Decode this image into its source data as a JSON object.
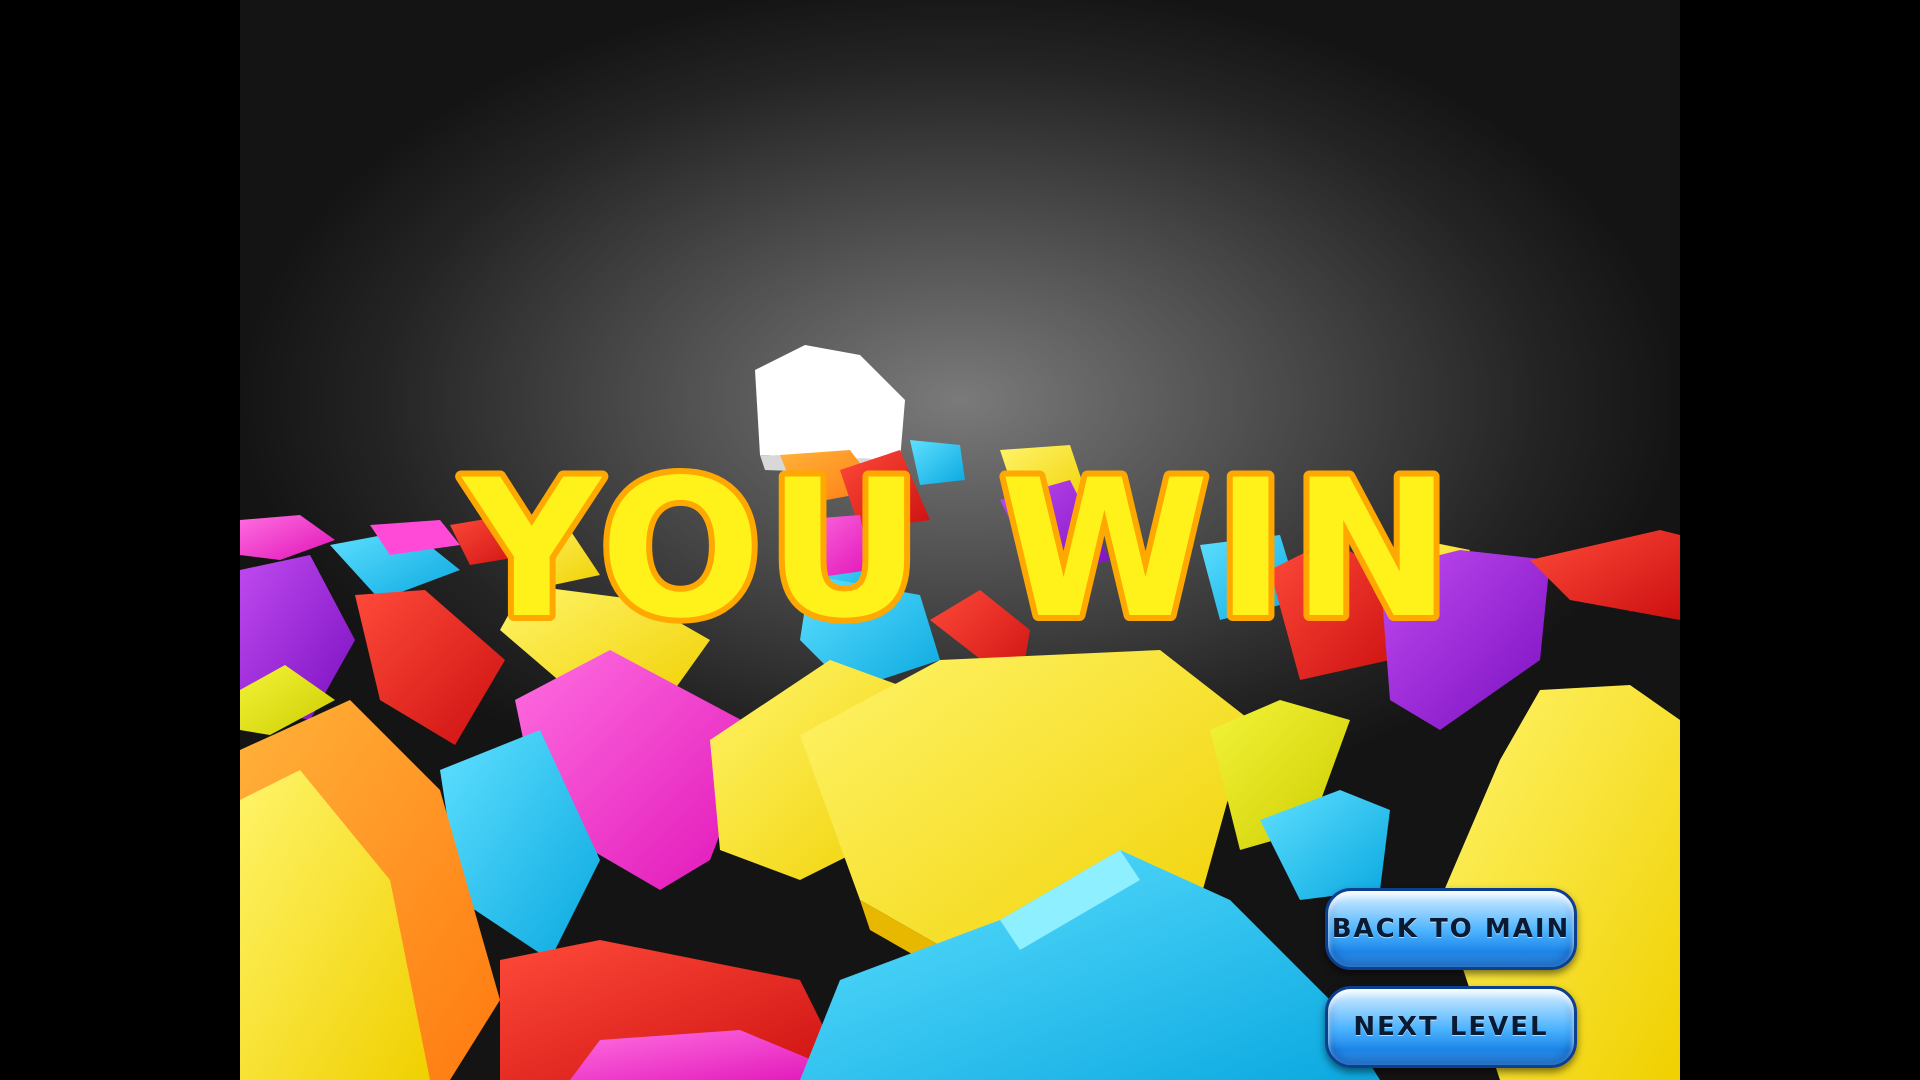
{
  "game": {
    "title": "YOU WIN",
    "title_colors": {
      "fill": "#fff21a",
      "outline": "#ffb400"
    },
    "buttons": {
      "back_to_main": "BACK TO MAIN",
      "next_level": "NEXT LEVEL"
    },
    "block_colors": [
      "#ffe600",
      "#ff9a1a",
      "#e0e000",
      "#19c3f0",
      "#ff2fc8",
      "#e81c1c",
      "#a01ee0",
      "#ffffff"
    ]
  }
}
